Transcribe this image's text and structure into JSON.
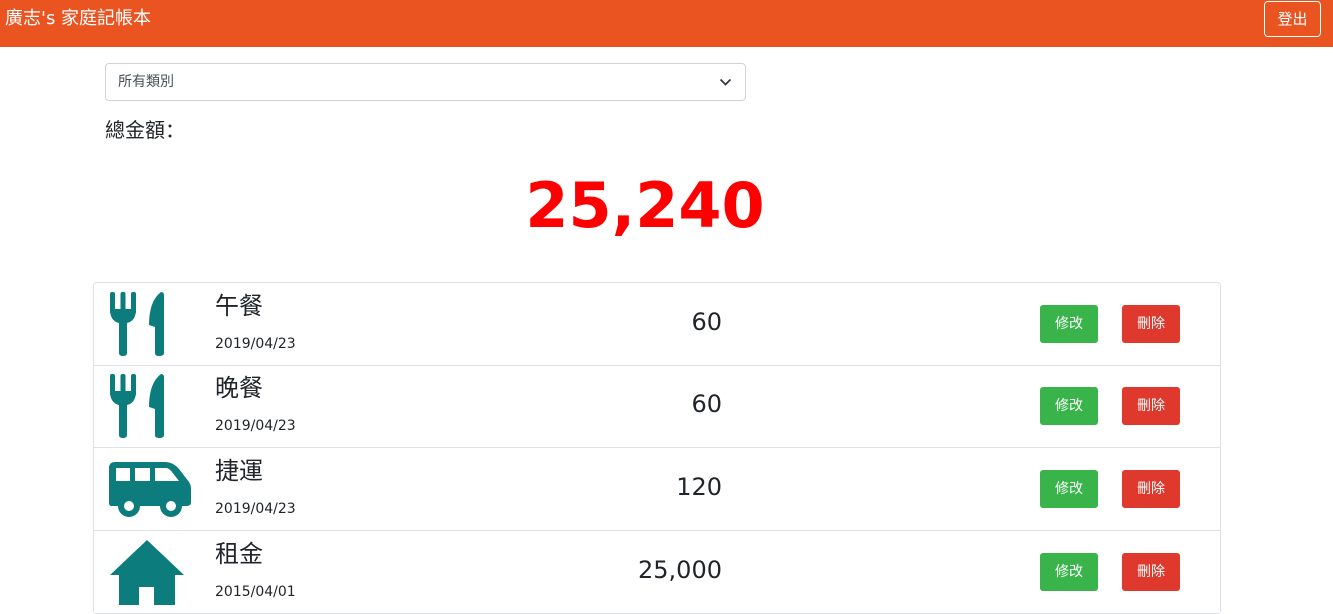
{
  "navbar": {
    "brand": "廣志's 家庭記帳本",
    "logout_label": "登出",
    "color": "#e95420"
  },
  "filter": {
    "selected": "所有類別"
  },
  "total": {
    "label": "總金額：",
    "amount": "25,240",
    "color": "#ff0000"
  },
  "records": [
    {
      "icon": "utensils-icon",
      "name": "午餐",
      "date": "2019/04/23",
      "amount": "60",
      "edit_label": "修改",
      "delete_label": "刪除"
    },
    {
      "icon": "utensils-icon",
      "name": "晚餐",
      "date": "2019/04/23",
      "amount": "60",
      "edit_label": "修改",
      "delete_label": "刪除"
    },
    {
      "icon": "shuttle-van-icon",
      "name": "捷運",
      "date": "2019/04/23",
      "amount": "120",
      "edit_label": "修改",
      "delete_label": "刪除"
    },
    {
      "icon": "home-icon",
      "name": "租金",
      "date": "2015/04/01",
      "amount": "25,000",
      "edit_label": "修改",
      "delete_label": "刪除"
    }
  ],
  "colors": {
    "icon": "#0c7c7c",
    "edit_button": "#38b44a",
    "delete_button": "#df382c"
  }
}
